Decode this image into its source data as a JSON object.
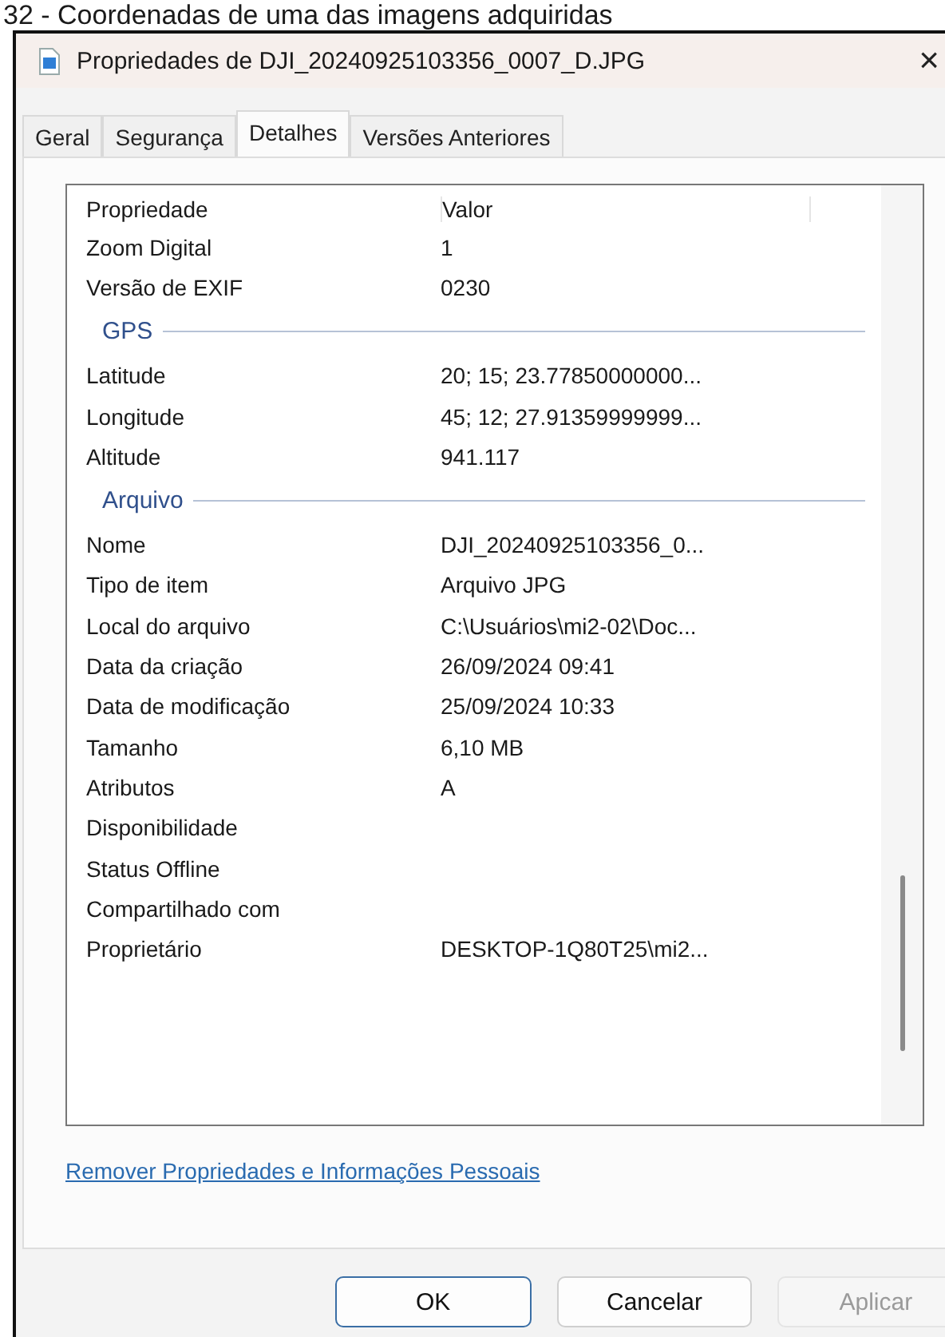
{
  "caption": "32 - Coordenadas de uma das imagens adquiridas",
  "window": {
    "title": "Propriedades de DJI_20240925103356_0007_D.JPG",
    "close": "×"
  },
  "tabs": [
    {
      "label": "Geral",
      "selected": false
    },
    {
      "label": "Segurança",
      "selected": false
    },
    {
      "label": "Detalhes",
      "selected": true
    },
    {
      "label": "Versões Anteriores",
      "selected": false
    }
  ],
  "table": {
    "columns": [
      "Propriedade",
      "Valor"
    ],
    "rows": [
      {
        "kind": "row",
        "name": "Zoom Digital",
        "value": "1"
      },
      {
        "kind": "row",
        "name": "Versão de EXIF",
        "value": "0230"
      },
      {
        "kind": "group",
        "name": "GPS"
      },
      {
        "kind": "row",
        "name": "Latitude",
        "value": "20; 15; 23.77850000000..."
      },
      {
        "kind": "row",
        "name": "Longitude",
        "value": "45; 12; 27.91359999999..."
      },
      {
        "kind": "row",
        "name": "Altitude",
        "value": "941.117"
      },
      {
        "kind": "group",
        "name": "Arquivo"
      },
      {
        "kind": "row",
        "name": "Nome",
        "value": "DJI_20240925103356_0..."
      },
      {
        "kind": "row",
        "name": "Tipo de item",
        "value": "Arquivo JPG"
      },
      {
        "kind": "row",
        "name": "Local do arquivo",
        "value": "C:\\Usuários\\mi2-02\\Doc..."
      },
      {
        "kind": "row",
        "name": "Data da criação",
        "value": "26/09/2024 09:41"
      },
      {
        "kind": "row",
        "name": "Data de modificação",
        "value": "25/09/2024 10:33"
      },
      {
        "kind": "row",
        "name": "Tamanho",
        "value": "6,10 MB"
      },
      {
        "kind": "row",
        "name": "Atributos",
        "value": "A"
      },
      {
        "kind": "row",
        "name": "Disponibilidade"
      },
      {
        "kind": "row",
        "name": "Status Offline"
      },
      {
        "kind": "row",
        "name": "Compartilhado com"
      },
      {
        "kind": "row",
        "name": "Proprietário",
        "value": "DESKTOP-1Q80T25\\mi2..."
      }
    ]
  },
  "link": "Remover Propriedades e Informações Pessoais",
  "buttons": [
    {
      "label": "OK",
      "disabled": false
    },
    {
      "label": "Cancelar",
      "disabled": false
    },
    {
      "label": "Aplicar",
      "disabled": true
    }
  ]
}
